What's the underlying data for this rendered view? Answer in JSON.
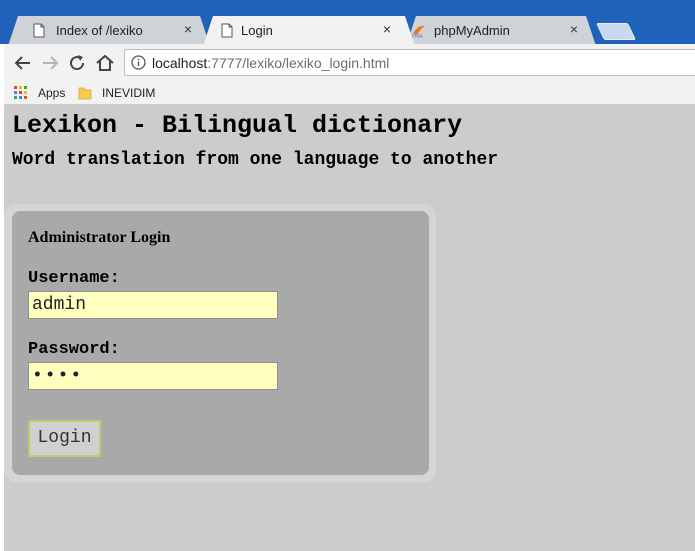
{
  "browser": {
    "tabs": [
      {
        "label": "Index of /lexiko",
        "close": "×"
      },
      {
        "label": "Login",
        "close": "×"
      },
      {
        "label": "phpMyAdmin",
        "close": "×"
      }
    ],
    "address": {
      "host": "localhost",
      "path": ":7777/lexiko/lexiko_login.html"
    },
    "bookmarks": [
      {
        "label": "Apps",
        "icon": "apps-grid-icon"
      },
      {
        "label": "INEVIDIM",
        "icon": "folder-icon"
      }
    ]
  },
  "page": {
    "title": "Lexikon - Bilingual dictionary",
    "subtitle": "Word translation from one language to another",
    "form": {
      "heading": "Administrator Login",
      "username_label": "Username:",
      "username_value": "admin",
      "password_label": "Password:",
      "password_value": "••••",
      "submit_label": "Login"
    }
  },
  "colors": {
    "tabstrip": "#1e63b9",
    "page_background": "#cccccc",
    "panel_background": "#a9a9a9",
    "input_background": "#ffffc0",
    "button_border": "#b8d06a"
  }
}
